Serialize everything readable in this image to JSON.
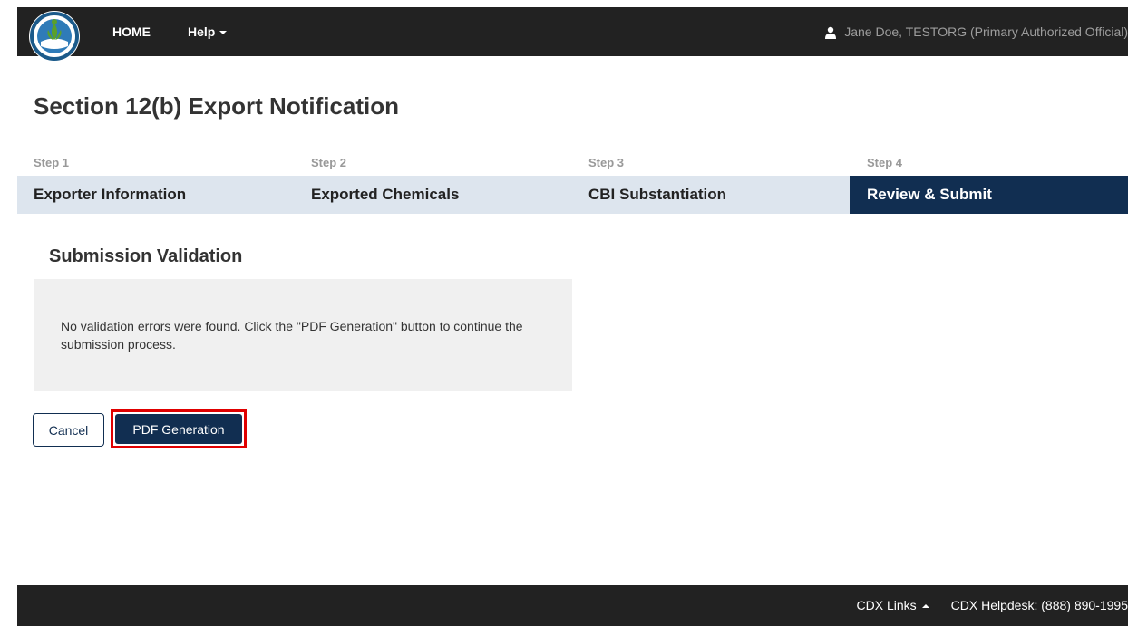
{
  "header": {
    "nav": {
      "home": "HOME",
      "help": "Help"
    },
    "user": "Jane Doe, TESTORG (Primary Authorized Official)"
  },
  "page": {
    "title": "Section 12(b) Export Notification"
  },
  "steps": [
    {
      "label": "Step 1",
      "name": "Exporter Information",
      "active": false
    },
    {
      "label": "Step 2",
      "name": "Exported Chemicals",
      "active": false
    },
    {
      "label": "Step 3",
      "name": "CBI Substantiation",
      "active": false
    },
    {
      "label": "Step 4",
      "name": "Review & Submit",
      "active": true
    }
  ],
  "validation": {
    "heading": "Submission Validation",
    "message": "No validation errors were found. Click the \"PDF Generation\" button to continue the submission process."
  },
  "actions": {
    "cancel": "Cancel",
    "pdf": "PDF Generation"
  },
  "footer": {
    "links": "CDX Links",
    "helpdesk": "CDX Helpdesk: (888) 890-1995"
  },
  "colors": {
    "navy": "#112e51",
    "highlight": "#e00000",
    "topbar": "#222222",
    "step_bar": "#dde5ee"
  },
  "icons": {
    "logo": "epa-seal-logo",
    "user": "user-icon",
    "help_caret": "caret-down-icon",
    "links_caret": "caret-up-icon"
  }
}
